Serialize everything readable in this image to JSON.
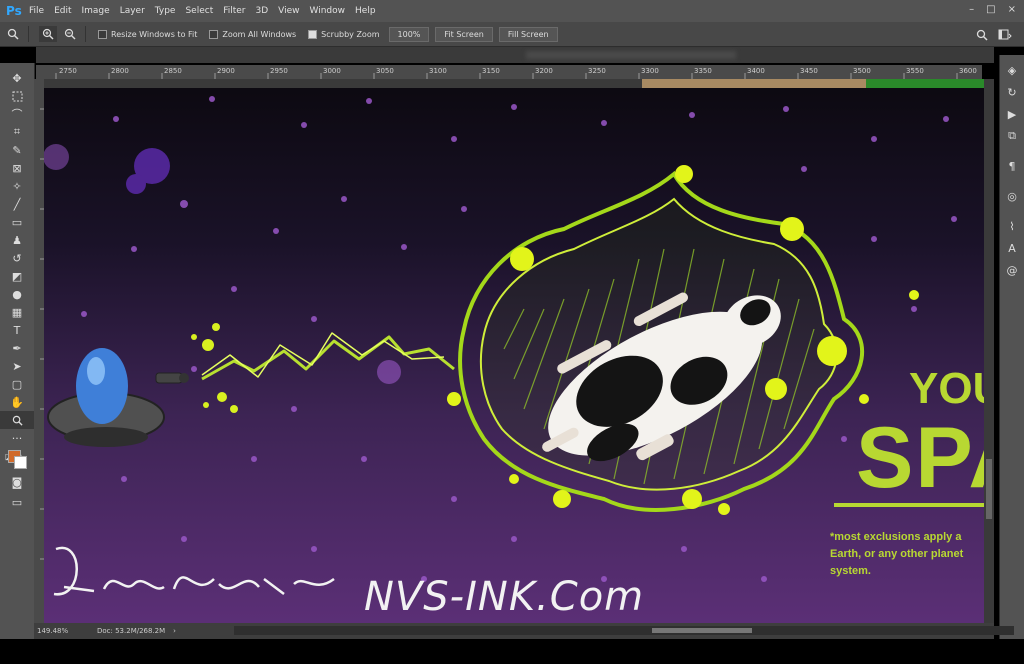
{
  "app": {
    "logo": "Ps"
  },
  "menu": [
    "File",
    "Edit",
    "Image",
    "Layer",
    "Type",
    "Select",
    "Filter",
    "3D",
    "View",
    "Window",
    "Help"
  ],
  "window_controls": [
    "–",
    "□",
    "×"
  ],
  "options_bar": {
    "tool_icon": "zoom-icon",
    "checkboxes": [
      {
        "label": "Resize Windows to Fit",
        "checked": false
      },
      {
        "label": "Zoom All Windows",
        "checked": false
      },
      {
        "label": "Scrubby Zoom",
        "checked": true
      }
    ],
    "zoom_button": "100%",
    "fit_button": "Fit Screen",
    "fill_button": "Fill Screen"
  },
  "ruler_ticks": [
    "2750",
    "2800",
    "2850",
    "2900",
    "2950",
    "3000",
    "3050",
    "3100",
    "3150",
    "3200",
    "3250",
    "3300",
    "3350",
    "3400",
    "3450",
    "3500",
    "3550",
    "3600"
  ],
  "status": {
    "zoom": "149.48%",
    "doc": "Doc: 53.2M/268.2M"
  },
  "artwork": {
    "headline_1": "YOU",
    "headline_2": "SPA",
    "fine_print": "*most exclusions apply a\nEarth, or any other planet\nsystem.",
    "url": "NVS-INK.Com"
  },
  "colors": {
    "foreground": "#d06a2a",
    "background": "#ffffff",
    "accent": "#b8d832"
  }
}
